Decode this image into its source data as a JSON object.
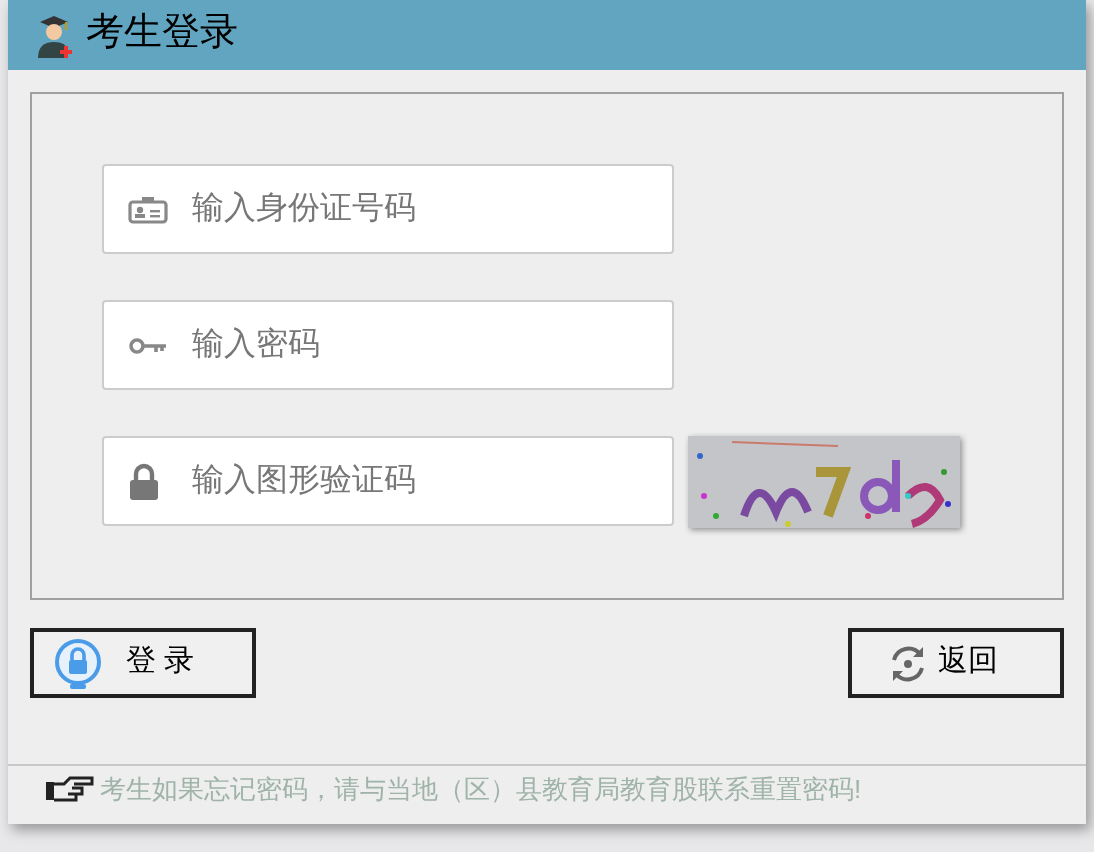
{
  "window": {
    "title": "考生登录"
  },
  "fields": [
    {
      "kind": "id",
      "placeholder": "输入身份证号码"
    },
    {
      "kind": "password",
      "placeholder": "输入密码"
    },
    {
      "kind": "captcha",
      "placeholder": "输入图形验证码"
    }
  ],
  "buttons": [
    {
      "kind": "login",
      "label": "登 录"
    },
    {
      "kind": "back",
      "label": "返回"
    }
  ],
  "footer": {
    "note": "考生如果忘记密码，请与当地（区）县教育局教育股联系重置密码!"
  }
}
